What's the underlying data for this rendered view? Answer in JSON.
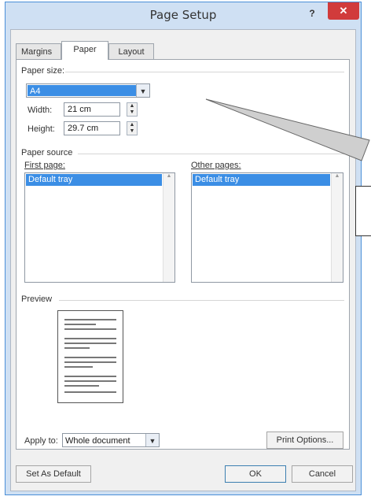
{
  "window": {
    "title": "Page Setup",
    "help": "?",
    "close": "✕"
  },
  "tabs": [
    {
      "label": "Margins"
    },
    {
      "label": "Paper"
    },
    {
      "label": "Layout"
    }
  ],
  "paper_size": {
    "group_label": "Paper size:",
    "selected": "A4",
    "width_label": "Width:",
    "width_value": "21 cm",
    "height_label": "Height:",
    "height_value": "29.7 cm"
  },
  "paper_source": {
    "group_label": "Paper source",
    "first_label": "First page:",
    "first_selected": "Default tray",
    "other_label": "Other pages:",
    "other_selected": "Default tray"
  },
  "preview": {
    "group_label": "Preview"
  },
  "apply_to": {
    "label": "Apply to:",
    "value": "Whole document"
  },
  "buttons": {
    "print_options": "Print Options...",
    "set_default": "Set As Default",
    "ok": "OK",
    "cancel": "Cancel"
  }
}
